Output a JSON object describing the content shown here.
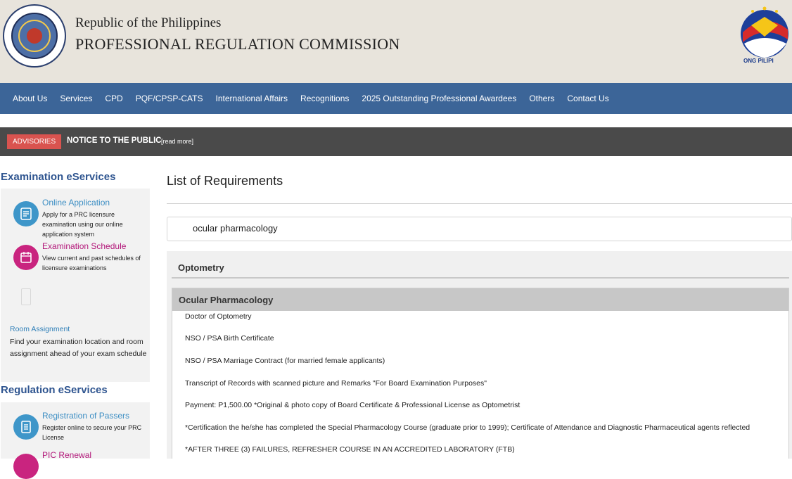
{
  "header": {
    "line1": "Republic of the Philippines",
    "line2": "PROFESSIONAL REGULATION COMMISSION",
    "seal_text_top": "PROFESSIONAL REGULATION COMMISSION",
    "seal_text_bottom": "REPUBLIC OF THE PHILIPPINES",
    "bp_logo_text": "ONG PILIPI"
  },
  "nav": {
    "items": [
      "About Us",
      "Services",
      "CPD",
      "PQF/CPSP-CATS",
      "International Affairs",
      "Recognitions",
      "2025 Outstanding Professional Awardees",
      "Others",
      "Contact Us"
    ]
  },
  "advisory": {
    "badge": "ADVISORIES",
    "notice": "NOTICE TO THE PUBLIC",
    "read_more": "[read more]"
  },
  "sidebar": {
    "exam_title": "Examination eServices",
    "exam_services": [
      {
        "title": "Online Application",
        "desc": "Apply for a PRC licensure examination using our online application system",
        "icon": "online-application-icon"
      },
      {
        "title": "Examination Schedule",
        "desc": "View current and past schedules of licensure examinations",
        "icon": "calendar-icon"
      }
    ],
    "room": {
      "title": "Room Assignment",
      "desc": "Find your examination location and room assignment ahead of your exam schedule"
    },
    "reg_title": "Regulation eServices",
    "reg_services": [
      {
        "title": "Registration of Passers",
        "desc": "Register online to secure your PRC License",
        "icon": "registration-icon"
      },
      {
        "title": "PIC Renewal",
        "desc": "",
        "icon": "renewal-icon"
      }
    ]
  },
  "main": {
    "title": "List of Requirements",
    "search_value": "ocular pharmacology",
    "accordion": {
      "outer_title": "Optometry",
      "inner_title": "Ocular Pharmacology",
      "requirements": [
        "Doctor of Optometry",
        "NSO / PSA Birth Certificate",
        "NSO / PSA Marriage Contract (for married female applicants)",
        "Transcript of Records with scanned picture and Remarks \"For Board Examination Purposes\"",
        "Payment: P1,500.00 *Original & photo copy of Board Certificate & Professional License as Optometrist",
        "*Certification the he/she has completed the Special Pharmacology Course (graduate prior to 1999); Certificate of Attendance and Diagnostic Pharmaceutical agents reflected",
        "*AFTER THREE (3) FAILURES, REFRESHER COURSE IN AN ACCREDITED LABORATORY (FTB)"
      ]
    }
  },
  "colors": {
    "nav_bg": "#3c6598",
    "advisory_bg": "#4a4a4a",
    "badge_bg": "#d9534f",
    "sidebar_title": "#2f5590",
    "accent_blue": "#3e96c9",
    "accent_magenta": "#c9247f"
  }
}
